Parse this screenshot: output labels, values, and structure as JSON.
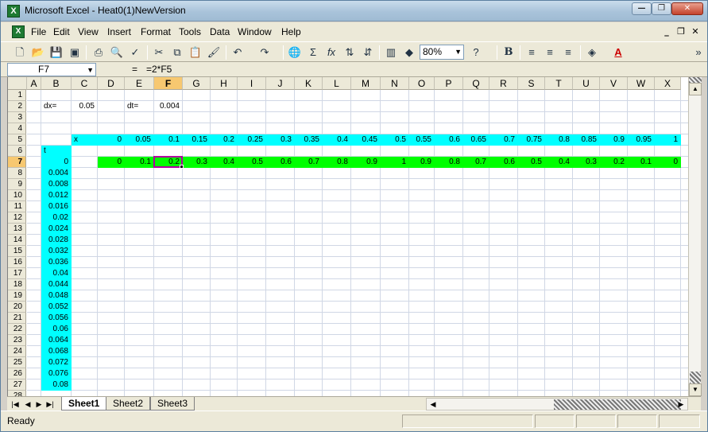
{
  "window": {
    "title": "Microsoft Excel - Heat0(1)NewVersion",
    "min_glyph": "—",
    "max_glyph": "❐",
    "close_glyph": "✕"
  },
  "menu": {
    "items": [
      "File",
      "Edit",
      "View",
      "Insert",
      "Format",
      "Tools",
      "Data",
      "Window",
      "Help"
    ],
    "doc_min": "_",
    "doc_restore": "❐",
    "doc_close": "✕"
  },
  "toolbar": {
    "zoom": "80%",
    "bold_label": "B",
    "font_color_label": "A",
    "icons": [
      "new-icon",
      "open-icon",
      "save-icon",
      "permission-icon",
      "print-icon",
      "print-preview-icon",
      "spelling-icon",
      "cut-icon",
      "copy-icon",
      "paste-icon",
      "format-painter-icon",
      "undo-icon",
      "redo-icon",
      "hyperlink-icon",
      "autosum-icon",
      "function-icon",
      "sort-ascending-icon",
      "sort-descending-icon",
      "chart-wizard-icon",
      "drawing-icon",
      "help-icon",
      "align-left-icon",
      "align-center-icon",
      "align-right-icon",
      "fill-color-icon"
    ],
    "overflow": "»"
  },
  "formula_bar": {
    "cell_ref": "F7",
    "equals": "=",
    "formula": "=2*F5"
  },
  "columns": [
    "A",
    "B",
    "C",
    "D",
    "E",
    "F",
    "G",
    "H",
    "I",
    "J",
    "K",
    "L",
    "M",
    "N",
    "O",
    "P",
    "Q",
    "R",
    "S",
    "T",
    "U",
    "V",
    "W",
    "X"
  ],
  "rows": [
    "1",
    "2",
    "3",
    "4",
    "5",
    "6",
    "7",
    "8",
    "9",
    "10",
    "11",
    "12",
    "13",
    "14",
    "15",
    "16",
    "17",
    "18",
    "19",
    "20",
    "21",
    "22",
    "23",
    "24",
    "25",
    "26",
    "27",
    "28"
  ],
  "active_column": "F",
  "active_row": "7",
  "cells": {
    "dx_label": "dx=",
    "dx_value": "0.05",
    "dt_label": "dt=",
    "dt_value": "0.004",
    "x_label": "x",
    "t_label": "t",
    "x_values": [
      "0",
      "0.05",
      "0.1",
      "0.15",
      "0.2",
      "0.25",
      "0.3",
      "0.35",
      "0.4",
      "0.45",
      "0.5",
      "0.55",
      "0.6",
      "0.65",
      "0.7",
      "0.75",
      "0.8",
      "0.85",
      "0.9",
      "0.95",
      "1"
    ],
    "u_row7": [
      "0",
      "0.1",
      "0.2",
      "0.3",
      "0.4",
      "0.5",
      "0.6",
      "0.7",
      "0.8",
      "0.9",
      "1",
      "0.9",
      "0.8",
      "0.7",
      "0.6",
      "0.5",
      "0.4",
      "0.3",
      "0.2",
      "0.1",
      "0"
    ],
    "t_values": [
      "0",
      "0.004",
      "0.008",
      "0.012",
      "0.016",
      "0.02",
      "0.024",
      "0.028",
      "0.032",
      "0.036",
      "0.04",
      "0.044",
      "0.048",
      "0.052",
      "0.056",
      "0.06",
      "0.064",
      "0.068",
      "0.072",
      "0.076",
      "0.08"
    ]
  },
  "sheets": {
    "tabs": [
      "Sheet1",
      "Sheet2",
      "Sheet3"
    ],
    "active": "Sheet1"
  },
  "status": {
    "text": "Ready"
  },
  "colors": {
    "x_row_fill": "#00ffff",
    "u_row_fill": "#00ff00",
    "selection_border": "#b0009f"
  }
}
